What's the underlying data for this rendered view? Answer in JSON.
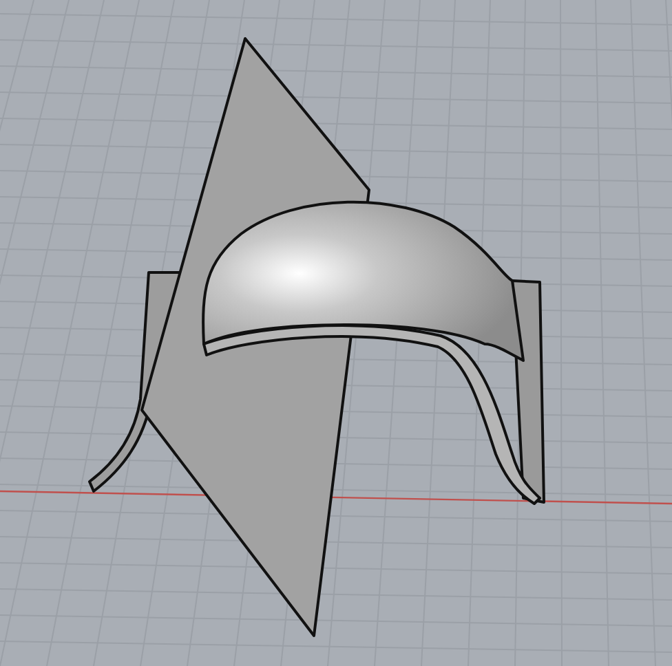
{
  "viewport": {
    "grid": true,
    "x_axis": true
  }
}
